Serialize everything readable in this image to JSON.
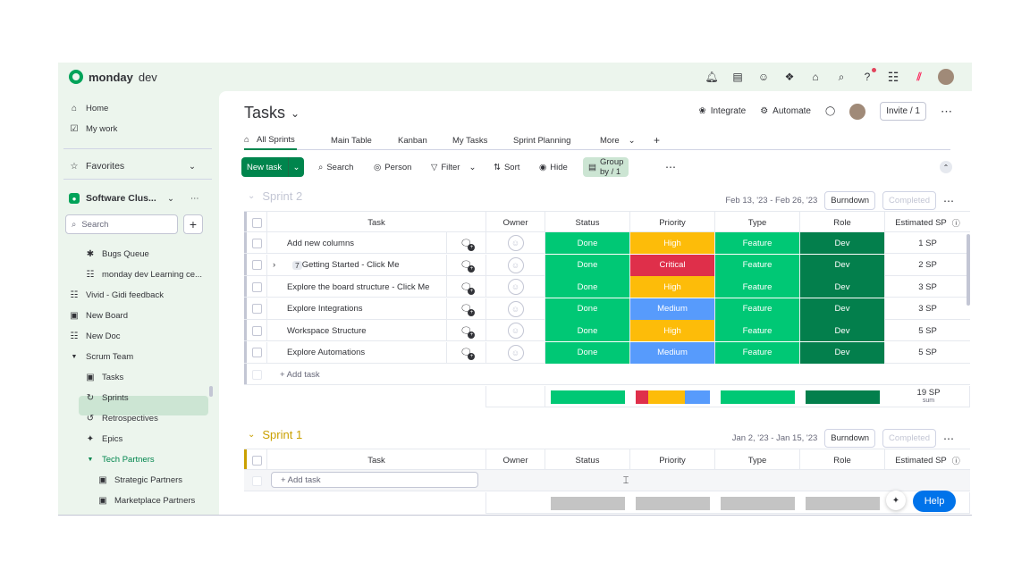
{
  "app": {
    "brand": "monday",
    "product": "dev"
  },
  "colors": {
    "done": "#00c875",
    "high": "#fdbc09",
    "critical": "#df2f4a",
    "medium": "#579bfc",
    "feature": "#00c875",
    "dev": "#037f4c",
    "accent": "#00854d",
    "sprint2": "#c3c6d4",
    "sprint1": "#caa000",
    "help": "#0073ea"
  },
  "sidebar": {
    "home": "Home",
    "my_work": "My work",
    "favorites": "Favorites",
    "workspace": "Software Clus...",
    "search_placeholder": "Search",
    "items": [
      {
        "label": "Bugs Queue",
        "icon": "bug-icon"
      },
      {
        "label": "monday dev Learning ce...",
        "icon": "doc-icon"
      },
      {
        "label": "Vivid - Gidi feedback",
        "icon": "doc-icon"
      },
      {
        "label": "New Board",
        "icon": "board-icon"
      },
      {
        "label": "New Doc",
        "icon": "doc-icon"
      },
      {
        "label": "Scrum Team",
        "icon": "folder-icon"
      },
      {
        "label": "Tasks",
        "icon": "board-icon"
      },
      {
        "label": "Sprints",
        "icon": "sprint-icon"
      },
      {
        "label": "Retrospectives",
        "icon": "retro-icon"
      },
      {
        "label": "Epics",
        "icon": "epic-icon"
      },
      {
        "label": "Tech Partners",
        "icon": "folder-icon"
      },
      {
        "label": "Strategic Partners",
        "icon": "board-icon"
      },
      {
        "label": "Marketplace Partners",
        "icon": "board-icon"
      }
    ]
  },
  "header": {
    "title": "Tasks",
    "integrate": "Integrate",
    "automate": "Automate",
    "invite": "Invite / 1"
  },
  "tabs": [
    "All Sprints",
    "Main Table",
    "Kanban",
    "My Tasks",
    "Sprint Planning",
    "More"
  ],
  "toolbar": {
    "new_task": "New task",
    "search": "Search",
    "person": "Person",
    "filter": "Filter",
    "sort": "Sort",
    "hide": "Hide",
    "group_by": "Group by / 1"
  },
  "columns": [
    "Task",
    "Owner",
    "Status",
    "Priority",
    "Type",
    "Role",
    "Estimated SP"
  ],
  "sprint2": {
    "name": "Sprint 2",
    "dates": "Feb 13, '23 - Feb 26, '23",
    "burndown": "Burndown",
    "completed": "Completed",
    "rows": [
      {
        "task": "Add new columns",
        "status": "Done",
        "priority": "High",
        "type": "Feature",
        "role": "Dev",
        "sp": "1 SP",
        "subitems": ""
      },
      {
        "task": "Getting Started - Click Me",
        "status": "Done",
        "priority": "Critical",
        "type": "Feature",
        "role": "Dev",
        "sp": "2 SP",
        "subitems": "7"
      },
      {
        "task": "Explore the board structure - Click Me",
        "status": "Done",
        "priority": "High",
        "type": "Feature",
        "role": "Dev",
        "sp": "3 SP",
        "subitems": ""
      },
      {
        "task": "Explore Integrations",
        "status": "Done",
        "priority": "Medium",
        "type": "Feature",
        "role": "Dev",
        "sp": "3 SP",
        "subitems": ""
      },
      {
        "task": "Workspace Structure",
        "status": "Done",
        "priority": "High",
        "type": "Feature",
        "role": "Dev",
        "sp": "5 SP",
        "subitems": ""
      },
      {
        "task": "Explore Automations",
        "status": "Done",
        "priority": "Medium",
        "type": "Feature",
        "role": "Dev",
        "sp": "5 SP",
        "subitems": ""
      }
    ],
    "add_task": "+ Add task",
    "sum_value": "19 SP",
    "sum_label": "sum"
  },
  "sprint1": {
    "name": "Sprint 1",
    "dates": "Jan 2, '23 - Jan 15, '23",
    "burndown": "Burndown",
    "completed": "Completed",
    "add_task": "+ Add task"
  },
  "help": "Help"
}
